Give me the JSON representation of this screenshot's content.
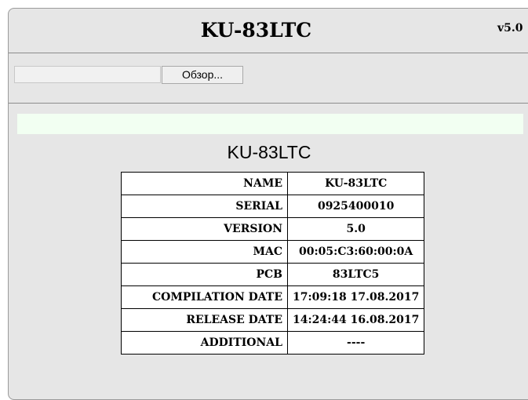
{
  "header": {
    "title": "KU-83LTC",
    "version": "v5.0"
  },
  "upload": {
    "file_value": "",
    "browse_label": "Обзор..."
  },
  "status": {
    "message": ""
  },
  "device": {
    "heading": "KU-83LTC",
    "info_rows": [
      {
        "key": "NAME",
        "value": "KU-83LTC"
      },
      {
        "key": "SERIAL",
        "value": "0925400010"
      },
      {
        "key": "VERSION",
        "value": "5.0"
      },
      {
        "key": "MAC",
        "value": "00:05:C3:60:00:0A"
      },
      {
        "key": "PCB",
        "value": "83LTC5"
      },
      {
        "key": "COMPILATION DATE",
        "value": "17:09:18 17.08.2017"
      },
      {
        "key": "RELEASE DATE",
        "value": "14:24:44 16.08.2017"
      },
      {
        "key": "ADDITIONAL",
        "value": "----"
      }
    ]
  },
  "colors": {
    "panel_bg": "#e6e6e6",
    "status_bg": "#f2fff2",
    "table_bg": "#ffffff"
  }
}
